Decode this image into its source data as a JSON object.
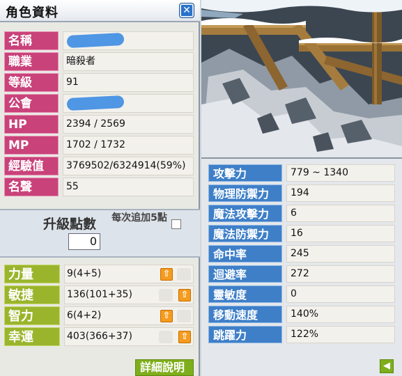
{
  "window": {
    "title": "角色資料",
    "close_icon": "close-icon"
  },
  "profile": {
    "rows": [
      {
        "label": "名稱",
        "value": ""
      },
      {
        "label": "職業",
        "value": "暗殺者"
      },
      {
        "label": "等級",
        "value": "91"
      },
      {
        "label": "公會",
        "value": ""
      },
      {
        "label": "HP",
        "value": "2394 / 2569"
      },
      {
        "label": "MP",
        "value": "1702 / 1732"
      },
      {
        "label": "經驗值",
        "value": "3769502/6324914(59%)"
      },
      {
        "label": "名聲",
        "value": "55"
      }
    ]
  },
  "level_points": {
    "label": "升級點數",
    "auto_add_label": "每次追加5點",
    "auto_add_checked": false,
    "value": "0"
  },
  "base_stats": [
    {
      "label": "力量",
      "value": "9(4+5)",
      "can_raise": true
    },
    {
      "label": "敏捷",
      "value": "136(101+35)",
      "can_raise": true
    },
    {
      "label": "智力",
      "value": "6(4+2)",
      "can_raise": true
    },
    {
      "label": "幸運",
      "value": "403(366+37)",
      "can_raise": true
    }
  ],
  "up_button_icon": "arrow-up-icon",
  "detail_button": {
    "label": "詳細說明",
    "icon": "chevron-right-icon"
  },
  "detail_stats": [
    {
      "label": "攻擊力",
      "value": "779 ~ 1340"
    },
    {
      "label": "物理防禦力",
      "value": "194"
    },
    {
      "label": "魔法攻擊力",
      "value": "6"
    },
    {
      "label": "魔法防禦力",
      "value": "16"
    },
    {
      "label": "命中率",
      "value": "245"
    },
    {
      "label": "迴避率",
      "value": "272"
    },
    {
      "label": "靈敏度",
      "value": "0"
    },
    {
      "label": "移動速度",
      "value": "140%"
    },
    {
      "label": "跳躍力",
      "value": "122%"
    }
  ],
  "back_button": {
    "icon": "arrow-left-icon"
  },
  "colors": {
    "profile_label": "#c9427a",
    "stat_label": "#9ab52c",
    "detail_label": "#3e7fc8",
    "raise_button": "#f59b1e"
  }
}
